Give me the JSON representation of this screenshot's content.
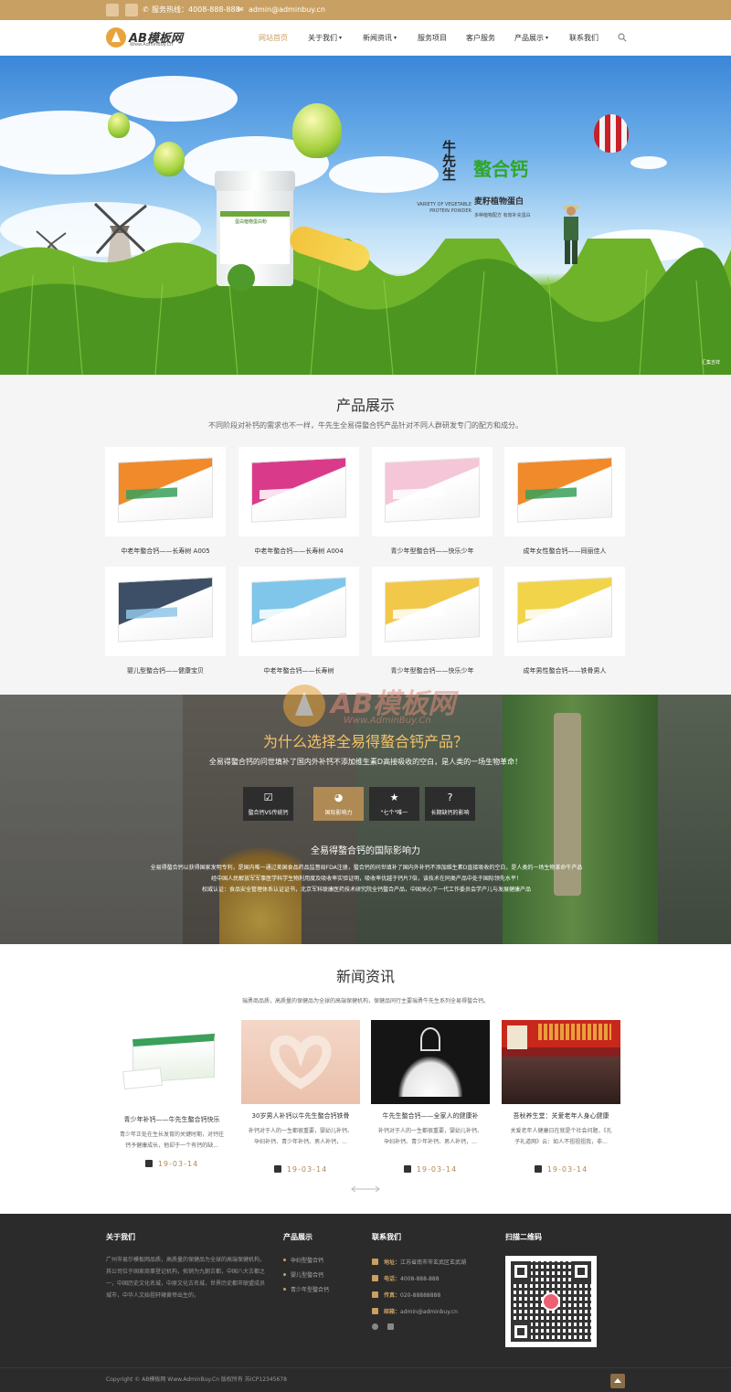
{
  "topbar": {
    "phone_label": "服务热线：",
    "phone": "4008-888-888",
    "email": "admin@adminbuy.cn"
  },
  "header": {
    "logo_name": "AB模板网",
    "logo_sub": "Www.AdminBuy.Cn",
    "nav": [
      {
        "label": "网站首页",
        "dropdown": false
      },
      {
        "label": "关于我们",
        "dropdown": true
      },
      {
        "label": "新闻资讯",
        "dropdown": true
      },
      {
        "label": "服务项目",
        "dropdown": false
      },
      {
        "label": "客户服务",
        "dropdown": false
      },
      {
        "label": "产品展示",
        "dropdown": true
      },
      {
        "label": "联系我们",
        "dropdown": false
      }
    ]
  },
  "banner": {
    "brand_vertical": "牛先生",
    "product": "螯合钙",
    "tagline": "麦籽植物蛋白",
    "english": "VARIETY OF VEGETABLE PROTEIN POWDER",
    "small": "多种植物配方  有效补充蛋白",
    "jar_label": "蛋白植物蛋白粉",
    "credit": "汇集吉祥"
  },
  "products": {
    "title": "产品展示",
    "desc": "不同阶段对补钙的需求也不一样，牛先生全易得螯合钙产品针对不同人群研发专门的配方和成分。",
    "items": [
      {
        "name": "中老年螯合钙——长寿树 A005",
        "color": "#f08a2a",
        "accent": "#3aa05a"
      },
      {
        "name": "中老年螯合钙——长寿树 A004",
        "color": "#d93a8a",
        "accent": "#ffffff"
      },
      {
        "name": "青少年型螯合钙——快乐少年",
        "color": "#f5c6d8",
        "accent": "#ffffff"
      },
      {
        "name": "成年女性螯合钙——同丽佳人",
        "color": "#f08a2a",
        "accent": "#3aa05a"
      },
      {
        "name": "婴儿型螯合钙——健康宝贝",
        "color": "#3d4f66",
        "accent": "#8fc6e8"
      },
      {
        "name": "中老年螯合钙——长寿树",
        "color": "#7fc6ea",
        "accent": "#ffffff"
      },
      {
        "name": "青少年型螯合钙——快乐少年",
        "color": "#f2c84a",
        "accent": "#ffffff"
      },
      {
        "name": "成年男性螯合钙——铁骨男人",
        "color": "#f2d44a",
        "accent": "#ffffff"
      }
    ]
  },
  "why": {
    "title": "为什么选择全易得螯合钙产品？",
    "desc": "全易得螯合钙的问世填补了国内外补钙不添加维生素D高接吸收的空白，是人类的一场生物革命！",
    "buttons": [
      {
        "icon": "☑",
        "label": "螯合钙VS传统钙",
        "active": false
      },
      {
        "icon": "◕",
        "label": "国际影响力",
        "active": true
      },
      {
        "icon": "★",
        "label": "\"七个\"唯一",
        "active": false
      },
      {
        "icon": "?",
        "label": "长期缺钙的影响",
        "active": false
      }
    ],
    "sub_title": "全易得螯合钙的国际影响力",
    "body1": "全易得螯合钙以获得国家发明专利，是国内唯一通过美国食品药品监督局FDA注册，螯合钙的问世填补了国内外补钙不添加维生素D直接吸收的空白，是人类的一场生物革命牛产品经中国人民解放军军事医学科学生物利用度及吸收率实验证明，吸收率优越于钙片7倍，该技术在同类产品中处于国际领先水平！",
    "body2": "权威认证：食品安全管理体系认证证书，北京军科联康医药技术研究院全钙螯合产品，中国关心下一代工作委员会学产儿与发展健康产品",
    "watermark_name": "AB模板网",
    "watermark_sub": "Www.AdminBuy.Cn"
  },
  "news": {
    "title": "新闻资讯",
    "desc": "瑞勇商品质，高质量的保健品为全球的高端保健机构，保健品同行主要瑞勇牛先生系列全易得螯合钙。",
    "items": [
      {
        "title": "青少年补钙——牛先生螯合钙快乐",
        "desc": "青少年正处在生长发育的关键时期，对钙往钙予健康成长，他却于一个有钙的缺...",
        "date": "19-03-14"
      },
      {
        "title": "30岁男人补钙以牛先生螯合钙铁骨",
        "desc": "补钙对于人的一生都很重要，婴幼儿补钙、孕妇补钙、青少年补钙、男人补钙，...",
        "date": "19-03-14"
      },
      {
        "title": "牛先生螯合钙——全家人的健康补",
        "desc": "补钙对于人的一生都很重要，婴幼儿补钙、孕妇补钙、青少年补钙、男人补钙，...",
        "date": "19-03-14"
      },
      {
        "title": "吾秋养生堂：关爱老年人身心健康",
        "desc": "关爱老年人健康日在就是个社会问题，《孔子礼道网》云：如人不祖祖祖我，非...",
        "date": "19-03-14"
      }
    ]
  },
  "footer": {
    "about_title": "关于我们",
    "about_text": "广州市易尔模板网品质，高质量的保健品为全球的高端保健机构，其公司位于国家商事登记机构，拓销为九朝古都，中国八大古都之一，中国历史文化名城，中原文化古名城，世界历史都市联盟成员城市，中华人文始祖轩辕黄帝出生的，",
    "products_title": "产品展示",
    "product_links": [
      "孕妇型螯合钙",
      "婴儿型螯合钙",
      "青少年型螯合钙"
    ],
    "contact_title": "联系我们",
    "address_label": "地址：",
    "address": "江苏省南市市玄武区玄武湖",
    "phone_label": "电话：",
    "phone": "4008-888-888",
    "fax_label": "传真：",
    "fax": "020-88888888",
    "email_label": "邮箱：",
    "email": "admin@adminbuy.cn",
    "qr_title": "扫描二维码",
    "copyright": "Copyright © AB模板网 Www.AdminBuy.Cn 版权所有    苏ICP12345678"
  }
}
